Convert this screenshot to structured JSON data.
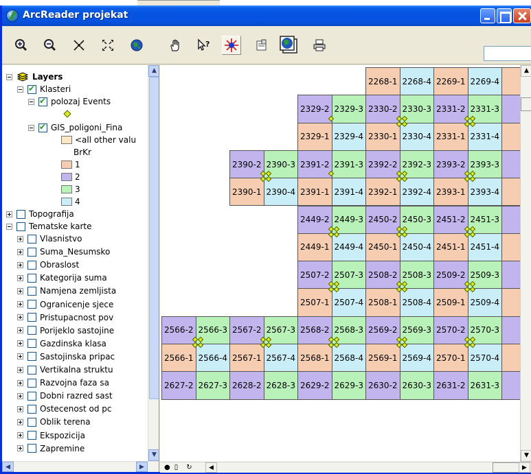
{
  "window": {
    "title": "ArcReader projekat"
  },
  "toolbar": {
    "tools": [
      {
        "name": "zoom-in-icon"
      },
      {
        "name": "zoom-out-icon"
      },
      {
        "name": "fixed-zoom-in-icon"
      },
      {
        "name": "fixed-zoom-out-icon"
      },
      {
        "name": "full-extent-icon"
      },
      {
        "name": "pan-icon"
      },
      {
        "name": "identify-icon"
      },
      {
        "name": "find-icon"
      },
      {
        "name": "properties-icon"
      },
      {
        "name": "globe-icon"
      },
      {
        "name": "print-icon"
      }
    ],
    "scale_value": ""
  },
  "toc": {
    "root": "Layers",
    "group_klasteri": "Klasteri",
    "layer_events": "polozaj Events",
    "layer_gis": "GIS_poligoni_Fina",
    "legend_other": "<all other valu",
    "legend_field": "BrKr",
    "legend_classes": [
      {
        "label": "1",
        "color": "#f6cdb0"
      },
      {
        "label": "2",
        "color": "#c2b5ee"
      },
      {
        "label": "3",
        "color": "#b8f2b8"
      },
      {
        "label": "4",
        "color": "#c9eef8"
      }
    ],
    "other_color": "#fbe7c4",
    "point_color": "#dfe82a",
    "group_topografija": "Topografija",
    "group_tematske": "Tematske karte",
    "tematske_items": [
      "Vlasnistvo",
      "Suma_Nesumsko",
      "Obraslost",
      "Kategorija suma",
      "Namjena zemljista",
      "Ogranicenje sjece",
      "Pristupacnost pov",
      "Porijeklo sastojine",
      "Gazdinska klasa",
      "Sastojinska pripac",
      "Vertikalna struktu",
      "Razvojna faza sa",
      "Dobni razred sast",
      "Ostecenost od pc",
      "Oblik terena",
      "Ekspozicija",
      "Zapremine"
    ]
  },
  "map": {
    "cells": [
      {
        "r": 0,
        "c": 6,
        "label": "2268-1",
        "cls": 1
      },
      {
        "r": 0,
        "c": 7,
        "label": "2268-4",
        "cls": 4
      },
      {
        "r": 0,
        "c": 8,
        "label": "2269-1",
        "cls": 1
      },
      {
        "r": 0,
        "c": 9,
        "label": "2269-4",
        "cls": 4
      },
      {
        "r": 0,
        "c": 10,
        "label": "",
        "cls": 1
      },
      {
        "r": 1,
        "c": 4,
        "label": "2329-2",
        "cls": 2
      },
      {
        "r": 1,
        "c": 5,
        "label": "2329-3",
        "cls": 3
      },
      {
        "r": 1,
        "c": 6,
        "label": "2330-2",
        "cls": 2
      },
      {
        "r": 1,
        "c": 7,
        "label": "2330-3",
        "cls": 3
      },
      {
        "r": 1,
        "c": 8,
        "label": "2331-2",
        "cls": 2
      },
      {
        "r": 1,
        "c": 9,
        "label": "2331-3",
        "cls": 3
      },
      {
        "r": 1,
        "c": 10,
        "label": "",
        "cls": 2
      },
      {
        "r": 2,
        "c": 4,
        "label": "2329-1",
        "cls": 1
      },
      {
        "r": 2,
        "c": 5,
        "label": "2329-4",
        "cls": 4
      },
      {
        "r": 2,
        "c": 6,
        "label": "2330-1",
        "cls": 1
      },
      {
        "r": 2,
        "c": 7,
        "label": "2330-4",
        "cls": 4
      },
      {
        "r": 2,
        "c": 8,
        "label": "2331-1",
        "cls": 1
      },
      {
        "r": 2,
        "c": 9,
        "label": "2331-4",
        "cls": 4
      },
      {
        "r": 2,
        "c": 10,
        "label": "",
        "cls": 1
      },
      {
        "r": 3,
        "c": 2,
        "label": "2390-2",
        "cls": 2
      },
      {
        "r": 3,
        "c": 3,
        "label": "2390-3",
        "cls": 3
      },
      {
        "r": 3,
        "c": 4,
        "label": "2391-2",
        "cls": 2
      },
      {
        "r": 3,
        "c": 5,
        "label": "2391-3",
        "cls": 3
      },
      {
        "r": 3,
        "c": 6,
        "label": "2392-2",
        "cls": 2
      },
      {
        "r": 3,
        "c": 7,
        "label": "2392-3",
        "cls": 3
      },
      {
        "r": 3,
        "c": 8,
        "label": "2393-2",
        "cls": 2
      },
      {
        "r": 3,
        "c": 9,
        "label": "2393-3",
        "cls": 3
      },
      {
        "r": 3,
        "c": 10,
        "label": "",
        "cls": 2
      },
      {
        "r": 4,
        "c": 2,
        "label": "2390-1",
        "cls": 1
      },
      {
        "r": 4,
        "c": 3,
        "label": "2390-4",
        "cls": 4
      },
      {
        "r": 4,
        "c": 4,
        "label": "2391-1",
        "cls": 1
      },
      {
        "r": 4,
        "c": 5,
        "label": "2391-4",
        "cls": 4
      },
      {
        "r": 4,
        "c": 6,
        "label": "2392-1",
        "cls": 1
      },
      {
        "r": 4,
        "c": 7,
        "label": "2392-4",
        "cls": 4
      },
      {
        "r": 4,
        "c": 8,
        "label": "2393-1",
        "cls": 1
      },
      {
        "r": 4,
        "c": 9,
        "label": "2393-4",
        "cls": 4
      },
      {
        "r": 4,
        "c": 10,
        "label": "",
        "cls": 1
      },
      {
        "r": 5,
        "c": 4,
        "label": "2449-2",
        "cls": 2
      },
      {
        "r": 5,
        "c": 5,
        "label": "2449-3",
        "cls": 3
      },
      {
        "r": 5,
        "c": 6,
        "label": "2450-2",
        "cls": 2
      },
      {
        "r": 5,
        "c": 7,
        "label": "2450-3",
        "cls": 3
      },
      {
        "r": 5,
        "c": 8,
        "label": "2451-2",
        "cls": 2
      },
      {
        "r": 5,
        "c": 9,
        "label": "2451-3",
        "cls": 3
      },
      {
        "r": 5,
        "c": 10,
        "label": "",
        "cls": 2
      },
      {
        "r": 6,
        "c": 4,
        "label": "2449-1",
        "cls": 1
      },
      {
        "r": 6,
        "c": 5,
        "label": "2449-4",
        "cls": 4
      },
      {
        "r": 6,
        "c": 6,
        "label": "2450-1",
        "cls": 1
      },
      {
        "r": 6,
        "c": 7,
        "label": "2450-4",
        "cls": 4
      },
      {
        "r": 6,
        "c": 8,
        "label": "2451-1",
        "cls": 1
      },
      {
        "r": 6,
        "c": 9,
        "label": "2451-4",
        "cls": 4
      },
      {
        "r": 6,
        "c": 10,
        "label": "",
        "cls": 1
      },
      {
        "r": 7,
        "c": 4,
        "label": "2507-2",
        "cls": 2
      },
      {
        "r": 7,
        "c": 5,
        "label": "2507-3",
        "cls": 3
      },
      {
        "r": 7,
        "c": 6,
        "label": "2508-2",
        "cls": 2
      },
      {
        "r": 7,
        "c": 7,
        "label": "2508-3",
        "cls": 3
      },
      {
        "r": 7,
        "c": 8,
        "label": "2509-2",
        "cls": 2
      },
      {
        "r": 7,
        "c": 9,
        "label": "2509-3",
        "cls": 3
      },
      {
        "r": 7,
        "c": 10,
        "label": "",
        "cls": 2
      },
      {
        "r": 8,
        "c": 4,
        "label": "2507-1",
        "cls": 1
      },
      {
        "r": 8,
        "c": 5,
        "label": "2507-4",
        "cls": 4
      },
      {
        "r": 8,
        "c": 6,
        "label": "2508-1",
        "cls": 1
      },
      {
        "r": 8,
        "c": 7,
        "label": "2508-4",
        "cls": 4
      },
      {
        "r": 8,
        "c": 8,
        "label": "2509-1",
        "cls": 1
      },
      {
        "r": 8,
        "c": 9,
        "label": "2509-4",
        "cls": 4
      },
      {
        "r": 8,
        "c": 10,
        "label": "",
        "cls": 1
      },
      {
        "r": 9,
        "c": 0,
        "label": "2566-2",
        "cls": 2
      },
      {
        "r": 9,
        "c": 1,
        "label": "2566-3",
        "cls": 3
      },
      {
        "r": 9,
        "c": 2,
        "label": "2567-2",
        "cls": 2
      },
      {
        "r": 9,
        "c": 3,
        "label": "2567-3",
        "cls": 3
      },
      {
        "r": 9,
        "c": 4,
        "label": "2568-2",
        "cls": 2
      },
      {
        "r": 9,
        "c": 5,
        "label": "2568-3",
        "cls": 3
      },
      {
        "r": 9,
        "c": 6,
        "label": "2569-2",
        "cls": 2
      },
      {
        "r": 9,
        "c": 7,
        "label": "2569-3",
        "cls": 3
      },
      {
        "r": 9,
        "c": 8,
        "label": "2570-2",
        "cls": 2
      },
      {
        "r": 9,
        "c": 9,
        "label": "2570-3",
        "cls": 3
      },
      {
        "r": 9,
        "c": 10,
        "label": "",
        "cls": 2
      },
      {
        "r": 10,
        "c": 0,
        "label": "2566-1",
        "cls": 1
      },
      {
        "r": 10,
        "c": 1,
        "label": "2566-4",
        "cls": 4
      },
      {
        "r": 10,
        "c": 2,
        "label": "2567-1",
        "cls": 1
      },
      {
        "r": 10,
        "c": 3,
        "label": "2567-4",
        "cls": 4
      },
      {
        "r": 10,
        "c": 4,
        "label": "2568-1",
        "cls": 1
      },
      {
        "r": 10,
        "c": 5,
        "label": "2568-4",
        "cls": 4
      },
      {
        "r": 10,
        "c": 6,
        "label": "2569-1",
        "cls": 1
      },
      {
        "r": 10,
        "c": 7,
        "label": "2569-4",
        "cls": 4
      },
      {
        "r": 10,
        "c": 8,
        "label": "2570-1",
        "cls": 1
      },
      {
        "r": 10,
        "c": 9,
        "label": "2570-4",
        "cls": 4
      },
      {
        "r": 10,
        "c": 10,
        "label": "",
        "cls": 1
      },
      {
        "r": 11,
        "c": 0,
        "label": "2627-2",
        "cls": 2
      },
      {
        "r": 11,
        "c": 1,
        "label": "2627-3",
        "cls": 3
      },
      {
        "r": 11,
        "c": 2,
        "label": "2628-2",
        "cls": 2
      },
      {
        "r": 11,
        "c": 3,
        "label": "2628-3",
        "cls": 3
      },
      {
        "r": 11,
        "c": 4,
        "label": "2629-2",
        "cls": 2
      },
      {
        "r": 11,
        "c": 5,
        "label": "2629-3",
        "cls": 3
      },
      {
        "r": 11,
        "c": 6,
        "label": "2630-2",
        "cls": 2
      },
      {
        "r": 11,
        "c": 7,
        "label": "2630-3",
        "cls": 3
      },
      {
        "r": 11,
        "c": 8,
        "label": "2631-2",
        "cls": 2
      },
      {
        "r": 11,
        "c": 9,
        "label": "2631-3",
        "cls": 3
      },
      {
        "r": 11,
        "c": 10,
        "label": "",
        "cls": 2
      }
    ],
    "class_colors": {
      "1": "#f6cdb0",
      "2": "#c2b5ee",
      "3": "#b8f2b8",
      "4": "#c9eef8"
    },
    "markers": [
      {
        "r": 1,
        "c": 5,
        "n": 1
      },
      {
        "r": 1,
        "c": 7,
        "n": 2
      },
      {
        "r": 1,
        "c": 9,
        "n": 2
      },
      {
        "r": 3,
        "c": 3,
        "n": 2
      },
      {
        "r": 3,
        "c": 5,
        "n": 1
      },
      {
        "r": 3,
        "c": 7,
        "n": 2
      },
      {
        "r": 3,
        "c": 9,
        "n": 2
      },
      {
        "r": 5,
        "c": 5,
        "n": 2
      },
      {
        "r": 5,
        "c": 7,
        "n": 2
      },
      {
        "r": 5,
        "c": 9,
        "n": 2
      },
      {
        "r": 7,
        "c": 5,
        "n": 2
      },
      {
        "r": 7,
        "c": 7,
        "n": 2
      },
      {
        "r": 7,
        "c": 9,
        "n": 2
      },
      {
        "r": 9,
        "c": 1,
        "n": 2
      },
      {
        "r": 9,
        "c": 3,
        "n": 2
      },
      {
        "r": 9,
        "c": 5,
        "n": 2
      },
      {
        "r": 9,
        "c": 7,
        "n": 2
      },
      {
        "r": 9,
        "c": 9,
        "n": 2
      }
    ]
  }
}
